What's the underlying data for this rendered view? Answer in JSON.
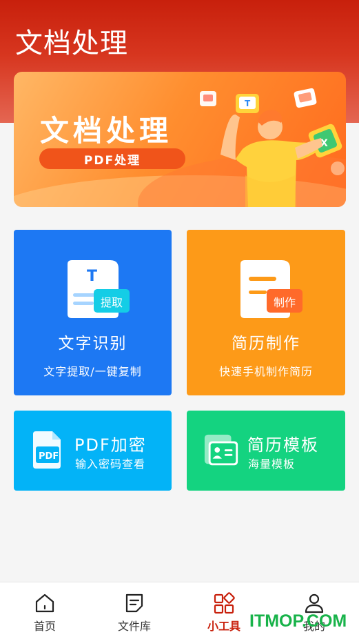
{
  "header": {
    "title": "文档处理"
  },
  "banner": {
    "title": "文档处理",
    "pill": "PDF处理"
  },
  "tools": {
    "ocr": {
      "title": "文字识别",
      "subtitle": "文字提取/一键复制",
      "badge": "提取",
      "icon": "text-extract-icon",
      "color": "#1d78f3"
    },
    "resume": {
      "title": "简历制作",
      "subtitle": "快速手机制作简历",
      "badge": "制作",
      "icon": "resume-make-icon",
      "color": "#fd9a18"
    },
    "pdf_encrypt": {
      "title": "PDF加密",
      "subtitle": "输入密码查看",
      "icon_text": "PDF",
      "icon": "pdf-file-icon",
      "color": "#03b3f7"
    },
    "resume_template": {
      "title": "简历模板",
      "subtitle": "海量模板",
      "icon": "id-card-icon",
      "color": "#14d380"
    }
  },
  "nav": {
    "items": [
      {
        "label": "首页",
        "icon": "home-icon",
        "active": false
      },
      {
        "label": "文件库",
        "icon": "document-icon",
        "active": false
      },
      {
        "label": "小工具",
        "icon": "tools-grid-icon",
        "active": true
      },
      {
        "label": "我的",
        "icon": "user-icon",
        "active": false
      }
    ],
    "active_color": "#c8200c"
  },
  "watermark": "ITMOP.COM"
}
